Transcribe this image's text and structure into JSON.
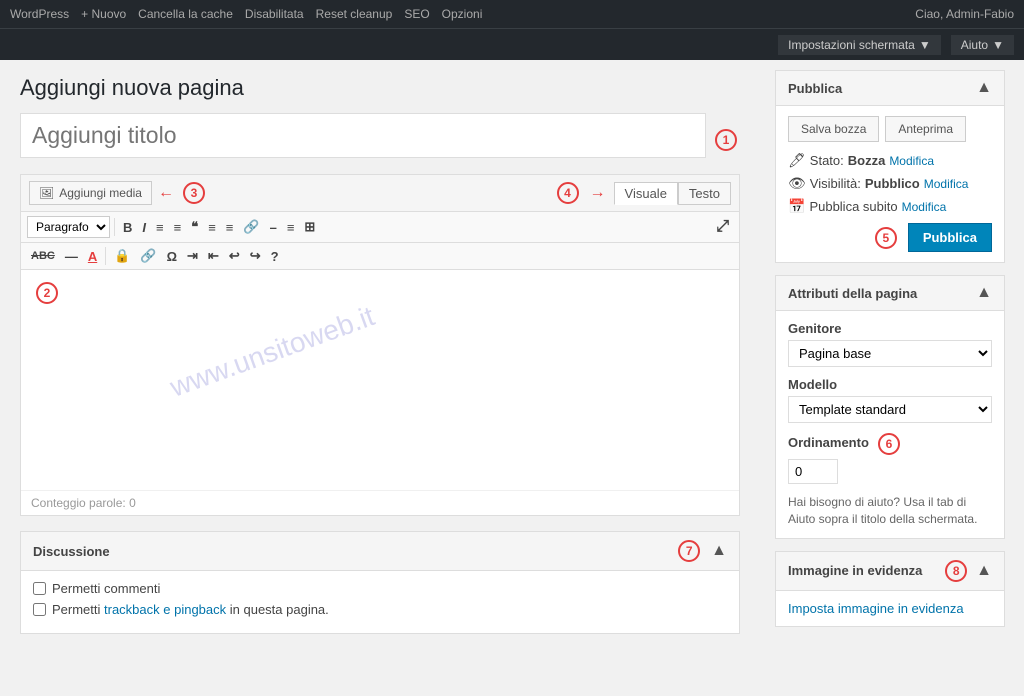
{
  "adminBar": {
    "items": [
      "WordPress",
      "+ Nuovo",
      "Cancella la cache",
      "Disabilitata",
      "Reset cleanup",
      "SEO",
      "Opzioni"
    ],
    "userLabel": "Ciao, Admin-Fabio",
    "buttons": [
      {
        "label": "Impostazioni schermata",
        "hasArrow": true
      },
      {
        "label": "Aiuto",
        "hasArrow": true
      }
    ]
  },
  "pageHeading": "Aggiungi nuova pagina",
  "titleInput": {
    "placeholder": "Aggiungi titolo",
    "value": ""
  },
  "annotations": {
    "1": "①",
    "2": "②",
    "3": "③",
    "4": "④",
    "5": "⑤",
    "6": "⑥",
    "7": "⑦",
    "8": "⑧"
  },
  "mediaButton": {
    "label": "Aggiungi media",
    "icon": "🖼"
  },
  "viewTabs": {
    "visuale": "Visuale",
    "testo": "Testo"
  },
  "toolbar": {
    "formatSelect": "Paragrafo",
    "buttons": [
      "B",
      "I",
      "≡",
      "≡",
      "❝",
      "≡",
      "≡",
      "–",
      "≡",
      "⊞"
    ],
    "row2": [
      "ABC",
      "—",
      "A",
      "🔒",
      "🔗",
      "Ω",
      "≡",
      "≡",
      "↩",
      "↪",
      "?"
    ]
  },
  "wordCount": {
    "label": "Conteggio parole: 0"
  },
  "discussione": {
    "title": "Discussione",
    "checkboxes": [
      {
        "label": "Permetti commenti"
      },
      {
        "label": "Permetti trackback e pingback in questa pagina."
      }
    ],
    "linkText": "trackback e pingback"
  },
  "pubblica": {
    "title": "Pubblica",
    "salvaBozza": "Salva bozza",
    "anteprima": "Anteprima",
    "statoLabel": "Stato:",
    "statoValue": "Bozza",
    "statoModifica": "Modifica",
    "visibilitaLabel": "Visibilità:",
    "visibilitaValue": "Pubblico",
    "visibilitaModifica": "Modifica",
    "pubblicaSubitoLabel": "Pubblica subito",
    "pubblicaSubitoModifica": "Modifica",
    "pubblicaBtn": "Pubblica"
  },
  "attributiPagina": {
    "title": "Attributi della pagina",
    "genitoreLabel": "Genitore",
    "genitoreValue": "Pagina base",
    "modelloLabel": "Modello",
    "modelloValue": "Template standard",
    "ordinamentoLabel": "Ordinamento",
    "ordinamentoValue": "0",
    "helpText": "Hai bisogno di aiuto? Usa il tab di Aiuto sopra il titolo della schermata."
  },
  "immagineInEvidenza": {
    "title": "Immagine in evidenza",
    "linkLabel": "Imposta immagine in evidenza"
  }
}
